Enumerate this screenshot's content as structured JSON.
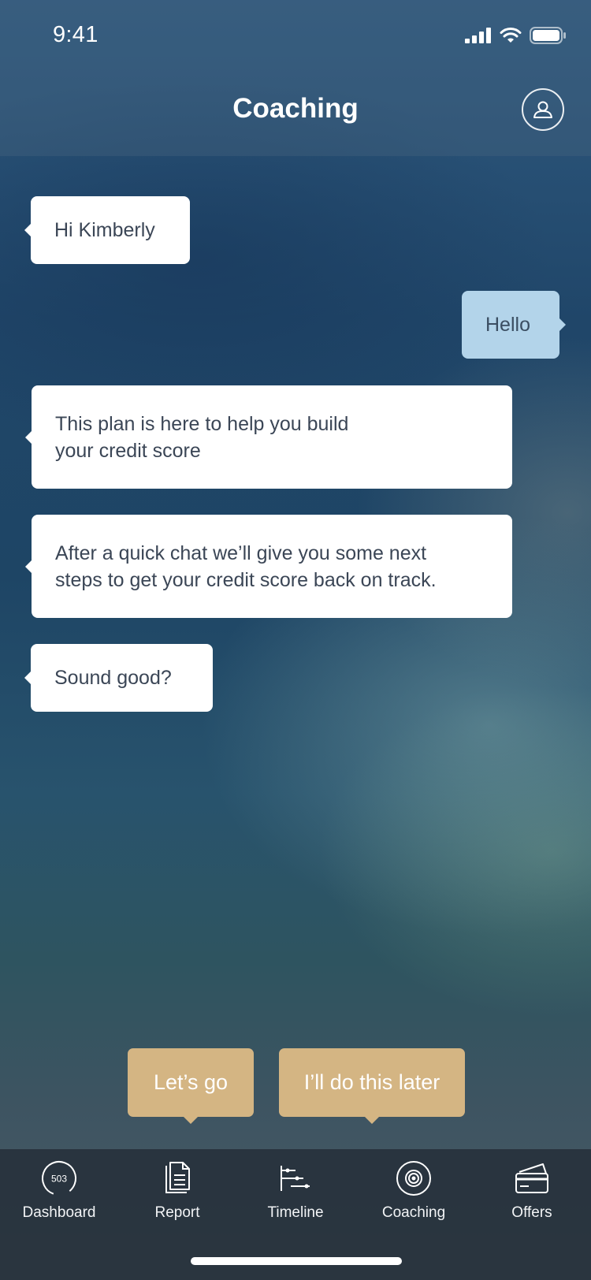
{
  "status_bar": {
    "time": "9:41"
  },
  "header": {
    "title": "Coaching"
  },
  "messages": [
    {
      "from": "coach",
      "text": "Hi Kimberly"
    },
    {
      "from": "user",
      "text": "Hello"
    },
    {
      "from": "coach",
      "text": "This plan is here to help you build\nyour credit score"
    },
    {
      "from": "coach",
      "text": "After a quick chat we’ll give you some next\nsteps to get your credit score back on track."
    },
    {
      "from": "coach",
      "text": "Sound good?"
    }
  ],
  "actions": {
    "primary": "Let’s go",
    "secondary": "I’ll do this later"
  },
  "tabbar": {
    "items": [
      {
        "label": "Dashboard",
        "icon": "score-gauge-icon",
        "badge": "503"
      },
      {
        "label": "Report",
        "icon": "document-icon"
      },
      {
        "label": "Timeline",
        "icon": "timeline-icon"
      },
      {
        "label": "Coaching",
        "icon": "target-icon",
        "active": true
      },
      {
        "label": "Offers",
        "icon": "cards-icon"
      }
    ]
  },
  "colors": {
    "action": "#d4b583",
    "user_bubble": "#b3d4ea",
    "coach_bubble": "#ffffff"
  }
}
